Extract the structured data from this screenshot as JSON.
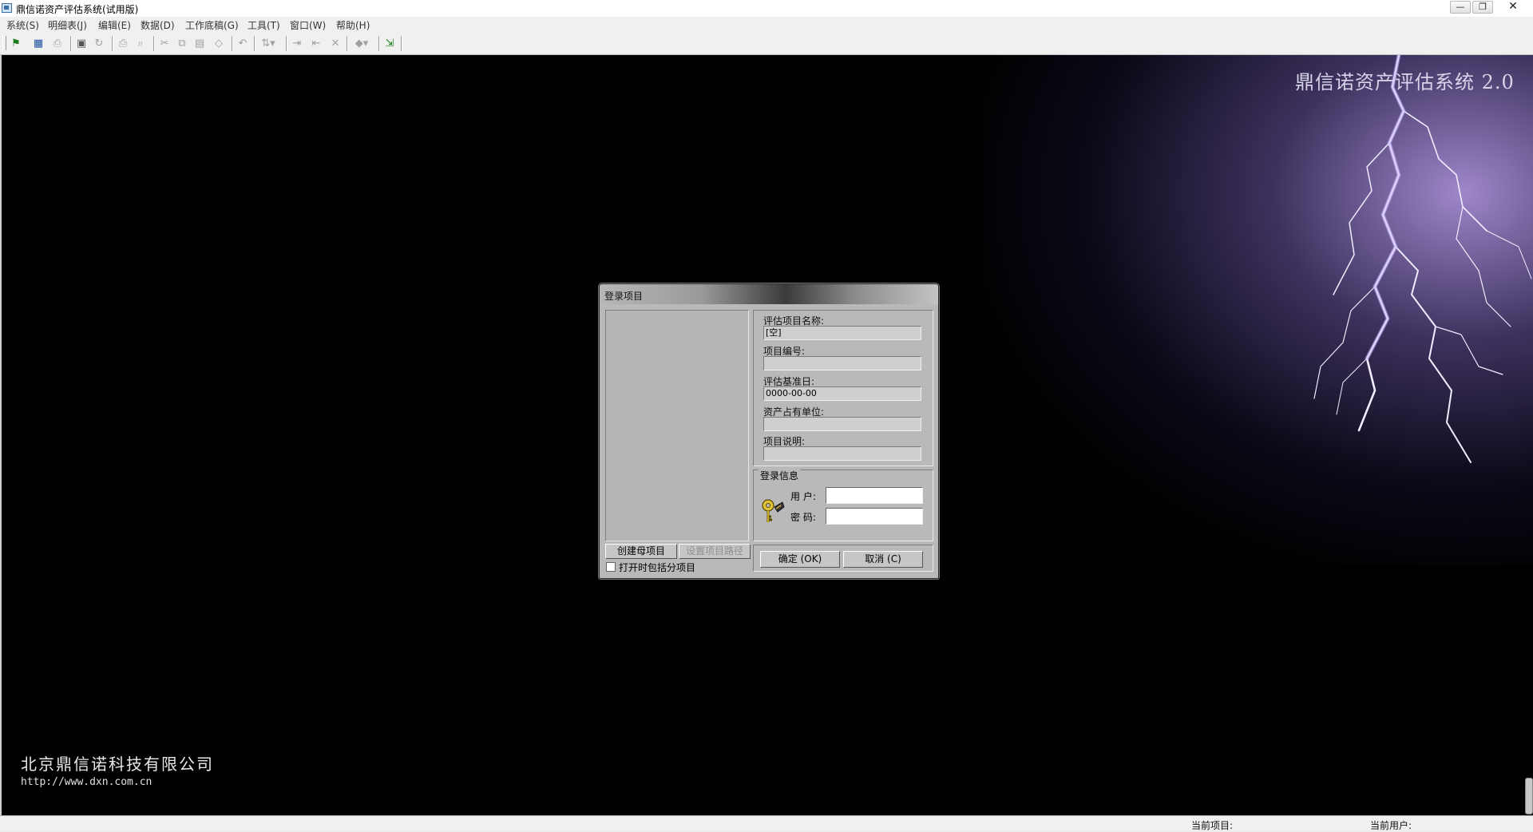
{
  "window": {
    "title": "鼎信诺资产评估系统(试用版)",
    "min_glyph": "—",
    "restore_glyph": "❐",
    "close_glyph": "✕"
  },
  "menu": [
    "系统(S)",
    "明细表(J)",
    "编辑(E)",
    "数据(D)",
    "工作底稿(G)",
    "工具(T)",
    "窗口(W)",
    "帮助(H)"
  ],
  "toolbar": {
    "icons": [
      "flag-icon",
      "grid-icon",
      "print-setup-icon",
      "save-icon",
      "refresh-icon",
      "print-icon",
      "print-preview-icon",
      "cut-icon",
      "copy-icon",
      "paste-icon",
      "eraser-icon",
      "undo-icon",
      "sort-icon",
      "indent-icon",
      "outdent-icon",
      "delete-icon",
      "tag-icon",
      "exit-icon"
    ]
  },
  "canvas": {
    "brand_title": "鼎信诺资产评估系统 2.0",
    "company_name": "北京鼎信诺科技有限公司",
    "company_url": "http://www.dxn.com.cn",
    "accent_glow": "#a996dc"
  },
  "dialog": {
    "title": "登录项目",
    "create_parent_label": "创建母项目",
    "set_path_label": "设置项目路径",
    "include_sub_label": "打开时包括分项目",
    "include_sub_checked": false,
    "fields": {
      "project_name_label": "评估项目名称:",
      "project_name_value": "[空]",
      "project_number_label": "项目编号:",
      "project_number_value": "",
      "base_date_label": "评估基准日:",
      "base_date_value": "0000-00-00",
      "asset_owner_label": "资产占有单位:",
      "asset_owner_value": "",
      "description_label": "项目说明:",
      "description_value": ""
    },
    "login": {
      "legend": "登录信息",
      "user_label": "用  户:",
      "user_value": "",
      "password_label": "密  码:",
      "password_value": ""
    },
    "ok_label": "确定 (OK)",
    "cancel_label": "取消 (C)"
  },
  "status": {
    "current_project_label": "当前项目:",
    "current_user_label": "当前用户:"
  }
}
